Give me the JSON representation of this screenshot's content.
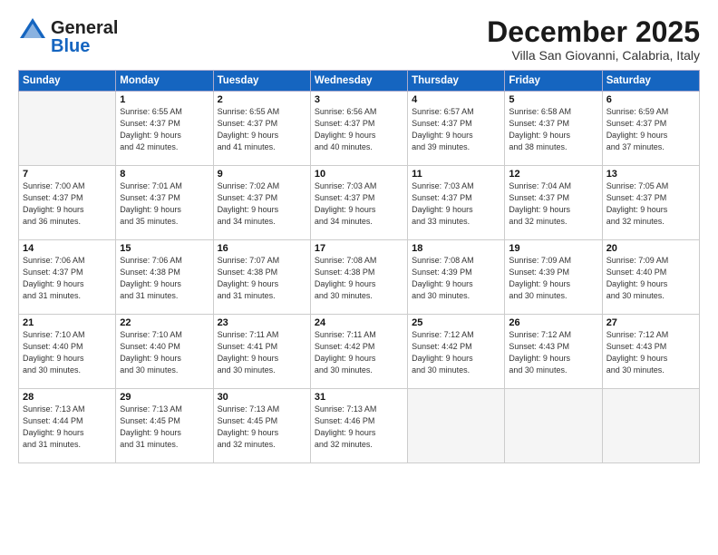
{
  "logo": {
    "general": "General",
    "blue": "Blue"
  },
  "title": "December 2025",
  "location": "Villa San Giovanni, Calabria, Italy",
  "days_header": [
    "Sunday",
    "Monday",
    "Tuesday",
    "Wednesday",
    "Thursday",
    "Friday",
    "Saturday"
  ],
  "weeks": [
    [
      {
        "day": "",
        "info": ""
      },
      {
        "day": "1",
        "info": "Sunrise: 6:55 AM\nSunset: 4:37 PM\nDaylight: 9 hours\nand 42 minutes."
      },
      {
        "day": "2",
        "info": "Sunrise: 6:55 AM\nSunset: 4:37 PM\nDaylight: 9 hours\nand 41 minutes."
      },
      {
        "day": "3",
        "info": "Sunrise: 6:56 AM\nSunset: 4:37 PM\nDaylight: 9 hours\nand 40 minutes."
      },
      {
        "day": "4",
        "info": "Sunrise: 6:57 AM\nSunset: 4:37 PM\nDaylight: 9 hours\nand 39 minutes."
      },
      {
        "day": "5",
        "info": "Sunrise: 6:58 AM\nSunset: 4:37 PM\nDaylight: 9 hours\nand 38 minutes."
      },
      {
        "day": "6",
        "info": "Sunrise: 6:59 AM\nSunset: 4:37 PM\nDaylight: 9 hours\nand 37 minutes."
      }
    ],
    [
      {
        "day": "7",
        "info": "Sunrise: 7:00 AM\nSunset: 4:37 PM\nDaylight: 9 hours\nand 36 minutes."
      },
      {
        "day": "8",
        "info": "Sunrise: 7:01 AM\nSunset: 4:37 PM\nDaylight: 9 hours\nand 35 minutes."
      },
      {
        "day": "9",
        "info": "Sunrise: 7:02 AM\nSunset: 4:37 PM\nDaylight: 9 hours\nand 34 minutes."
      },
      {
        "day": "10",
        "info": "Sunrise: 7:03 AM\nSunset: 4:37 PM\nDaylight: 9 hours\nand 34 minutes."
      },
      {
        "day": "11",
        "info": "Sunrise: 7:03 AM\nSunset: 4:37 PM\nDaylight: 9 hours\nand 33 minutes."
      },
      {
        "day": "12",
        "info": "Sunrise: 7:04 AM\nSunset: 4:37 PM\nDaylight: 9 hours\nand 32 minutes."
      },
      {
        "day": "13",
        "info": "Sunrise: 7:05 AM\nSunset: 4:37 PM\nDaylight: 9 hours\nand 32 minutes."
      }
    ],
    [
      {
        "day": "14",
        "info": "Sunrise: 7:06 AM\nSunset: 4:37 PM\nDaylight: 9 hours\nand 31 minutes."
      },
      {
        "day": "15",
        "info": "Sunrise: 7:06 AM\nSunset: 4:38 PM\nDaylight: 9 hours\nand 31 minutes."
      },
      {
        "day": "16",
        "info": "Sunrise: 7:07 AM\nSunset: 4:38 PM\nDaylight: 9 hours\nand 31 minutes."
      },
      {
        "day": "17",
        "info": "Sunrise: 7:08 AM\nSunset: 4:38 PM\nDaylight: 9 hours\nand 30 minutes."
      },
      {
        "day": "18",
        "info": "Sunrise: 7:08 AM\nSunset: 4:39 PM\nDaylight: 9 hours\nand 30 minutes."
      },
      {
        "day": "19",
        "info": "Sunrise: 7:09 AM\nSunset: 4:39 PM\nDaylight: 9 hours\nand 30 minutes."
      },
      {
        "day": "20",
        "info": "Sunrise: 7:09 AM\nSunset: 4:40 PM\nDaylight: 9 hours\nand 30 minutes."
      }
    ],
    [
      {
        "day": "21",
        "info": "Sunrise: 7:10 AM\nSunset: 4:40 PM\nDaylight: 9 hours\nand 30 minutes."
      },
      {
        "day": "22",
        "info": "Sunrise: 7:10 AM\nSunset: 4:40 PM\nDaylight: 9 hours\nand 30 minutes."
      },
      {
        "day": "23",
        "info": "Sunrise: 7:11 AM\nSunset: 4:41 PM\nDaylight: 9 hours\nand 30 minutes."
      },
      {
        "day": "24",
        "info": "Sunrise: 7:11 AM\nSunset: 4:42 PM\nDaylight: 9 hours\nand 30 minutes."
      },
      {
        "day": "25",
        "info": "Sunrise: 7:12 AM\nSunset: 4:42 PM\nDaylight: 9 hours\nand 30 minutes."
      },
      {
        "day": "26",
        "info": "Sunrise: 7:12 AM\nSunset: 4:43 PM\nDaylight: 9 hours\nand 30 minutes."
      },
      {
        "day": "27",
        "info": "Sunrise: 7:12 AM\nSunset: 4:43 PM\nDaylight: 9 hours\nand 30 minutes."
      }
    ],
    [
      {
        "day": "28",
        "info": "Sunrise: 7:13 AM\nSunset: 4:44 PM\nDaylight: 9 hours\nand 31 minutes."
      },
      {
        "day": "29",
        "info": "Sunrise: 7:13 AM\nSunset: 4:45 PM\nDaylight: 9 hours\nand 31 minutes."
      },
      {
        "day": "30",
        "info": "Sunrise: 7:13 AM\nSunset: 4:45 PM\nDaylight: 9 hours\nand 32 minutes."
      },
      {
        "day": "31",
        "info": "Sunrise: 7:13 AM\nSunset: 4:46 PM\nDaylight: 9 hours\nand 32 minutes."
      },
      {
        "day": "",
        "info": ""
      },
      {
        "day": "",
        "info": ""
      },
      {
        "day": "",
        "info": ""
      }
    ]
  ]
}
